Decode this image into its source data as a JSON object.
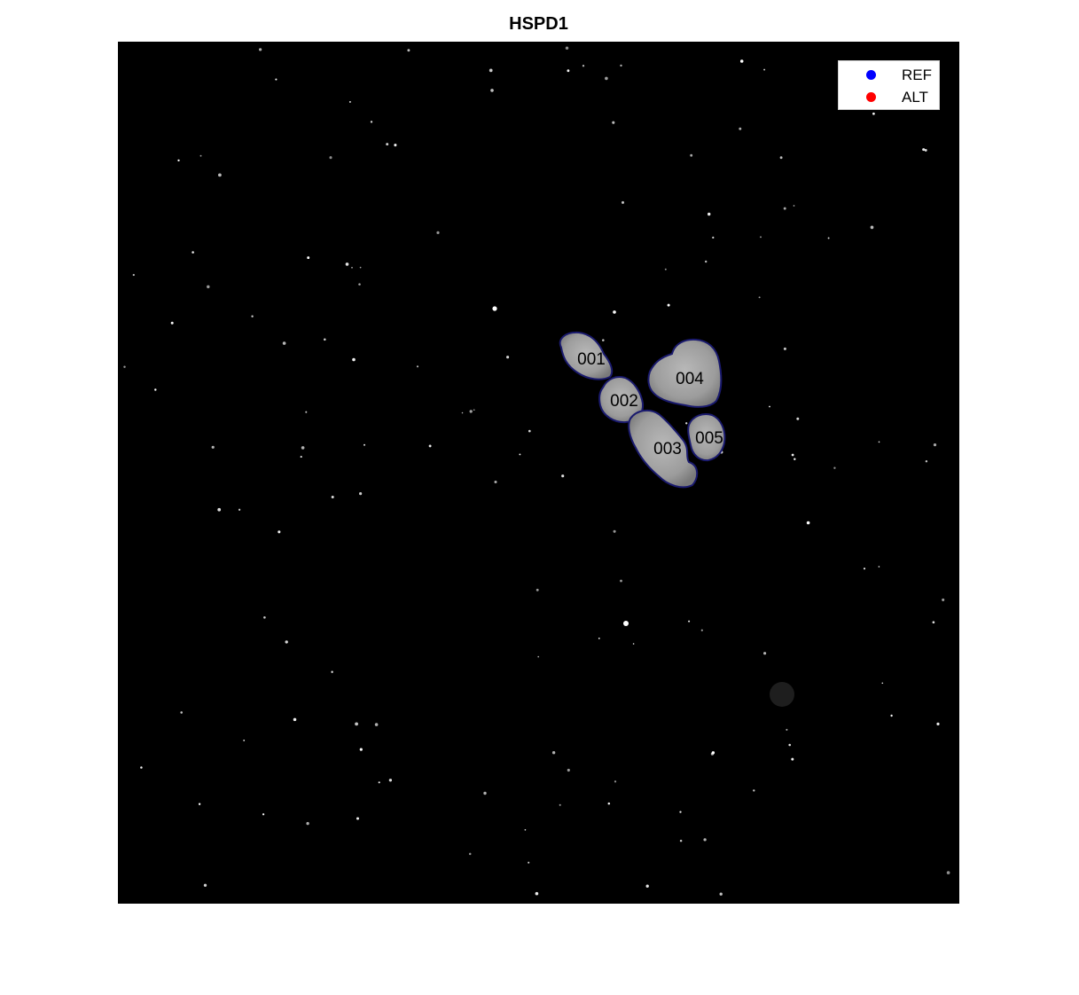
{
  "figure": {
    "title": "HSPD1",
    "background": "#000000",
    "outline_color": "#1a1a6e",
    "cell_fill": "#a8a8a8"
  },
  "legend": {
    "items": [
      {
        "label": "REF",
        "color": "#0000ff"
      },
      {
        "label": "ALT",
        "color": "#ff0000"
      }
    ]
  },
  "cells": [
    {
      "label": "001"
    },
    {
      "label": "002"
    },
    {
      "label": "003"
    },
    {
      "label": "004"
    },
    {
      "label": "005"
    }
  ]
}
